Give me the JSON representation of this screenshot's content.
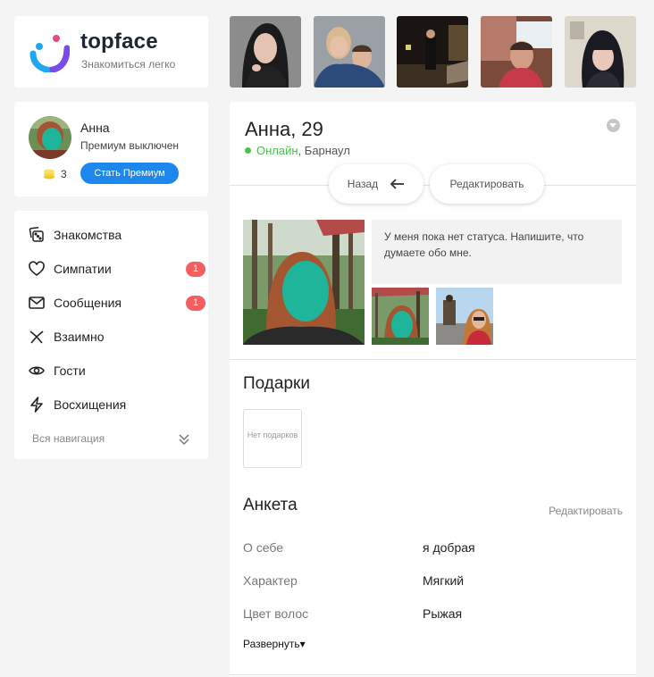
{
  "logo": {
    "title": "topface",
    "subtitle": "Знакомиться легко"
  },
  "user": {
    "name": "Анна",
    "premium_status": "Премиум выключен",
    "coins": "3",
    "premium_button": "Стать Премиум"
  },
  "nav": {
    "items": [
      {
        "label": "Знакомства",
        "icon": "dice-icon"
      },
      {
        "label": "Симпатии",
        "icon": "heart-icon",
        "badge": "1"
      },
      {
        "label": "Сообщения",
        "icon": "envelope-icon",
        "badge": "1"
      },
      {
        "label": "Взаимно",
        "icon": "mutual-icon"
      },
      {
        "label": "Гости",
        "icon": "eye-icon"
      },
      {
        "label": "Восхищения",
        "icon": "lightning-icon"
      }
    ],
    "all_label": "Вся навигация"
  },
  "profile": {
    "name_age": "Анна, 29",
    "online": "Онлайн",
    "city": ", Барнаул",
    "back_button": "Назад",
    "edit_button": "Редактировать",
    "status_text": "У меня пока нет статуса. Напишите, что думаете обо мне.",
    "gifts_title": "Подарки",
    "gifts_empty": "Нет подарков",
    "form_title": "Анкета",
    "form_edit": "Редактировать",
    "fields": [
      {
        "label": "О себе",
        "value": "я добрая"
      },
      {
        "label": "Характер",
        "value": "Мягкий"
      },
      {
        "label": "Цвет волос",
        "value": "Рыжая"
      }
    ],
    "expand": "Развернуть▾"
  },
  "colors": {
    "accent": "#1e87ec",
    "badge": "#f35f5f",
    "online": "#4bbf4b",
    "face_blur": "#1fb59a"
  }
}
